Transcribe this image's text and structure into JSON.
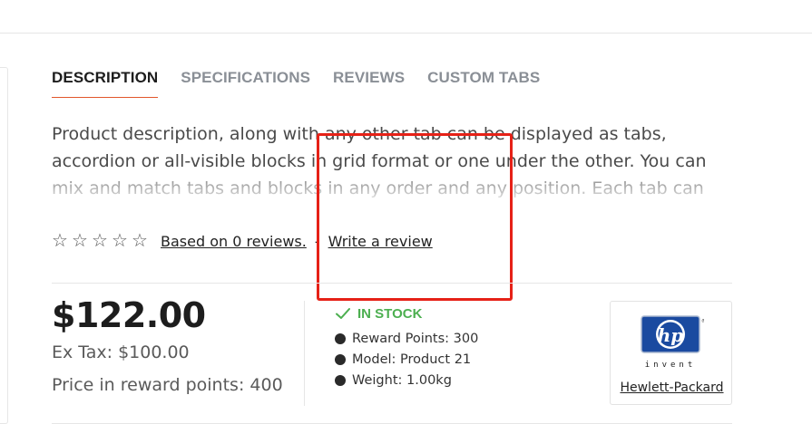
{
  "tabs": [
    {
      "label": "DESCRIPTION",
      "active": true
    },
    {
      "label": "SPECIFICATIONS",
      "active": false
    },
    {
      "label": "REVIEWS",
      "active": false
    },
    {
      "label": "CUSTOM TABS",
      "active": false
    }
  ],
  "description": {
    "text": "Product description, along with any other tab can be displayed as tabs, accordion or all-visible blocks in grid format or one under the other.  You can mix and match tabs and blocks in any order and any position. Each tab can also"
  },
  "rating": {
    "stars": 0,
    "max_stars": 5,
    "star_glyph": "☆",
    "reviews_label": "Based on 0 reviews.",
    "separator": "-",
    "write_review_label": "Write a review"
  },
  "pricing": {
    "price": "$122.00",
    "ex_tax": "Ex Tax: $100.00",
    "reward_price": "Price in reward points: 400"
  },
  "stock": {
    "label": "IN STOCK",
    "icon": "check-icon",
    "color": "#4caf50"
  },
  "specs": [
    "Reward Points: 300",
    "Model: Product 21",
    "Weight: 1.00kg"
  ],
  "brand": {
    "name": "Hewlett-Packard",
    "logo_text": "hp",
    "logo_tagline": "invent",
    "logo_color": "#1a4aa0"
  },
  "colors": {
    "tab_active_underline": "#e1562b",
    "highlight_box": "#e62117"
  }
}
